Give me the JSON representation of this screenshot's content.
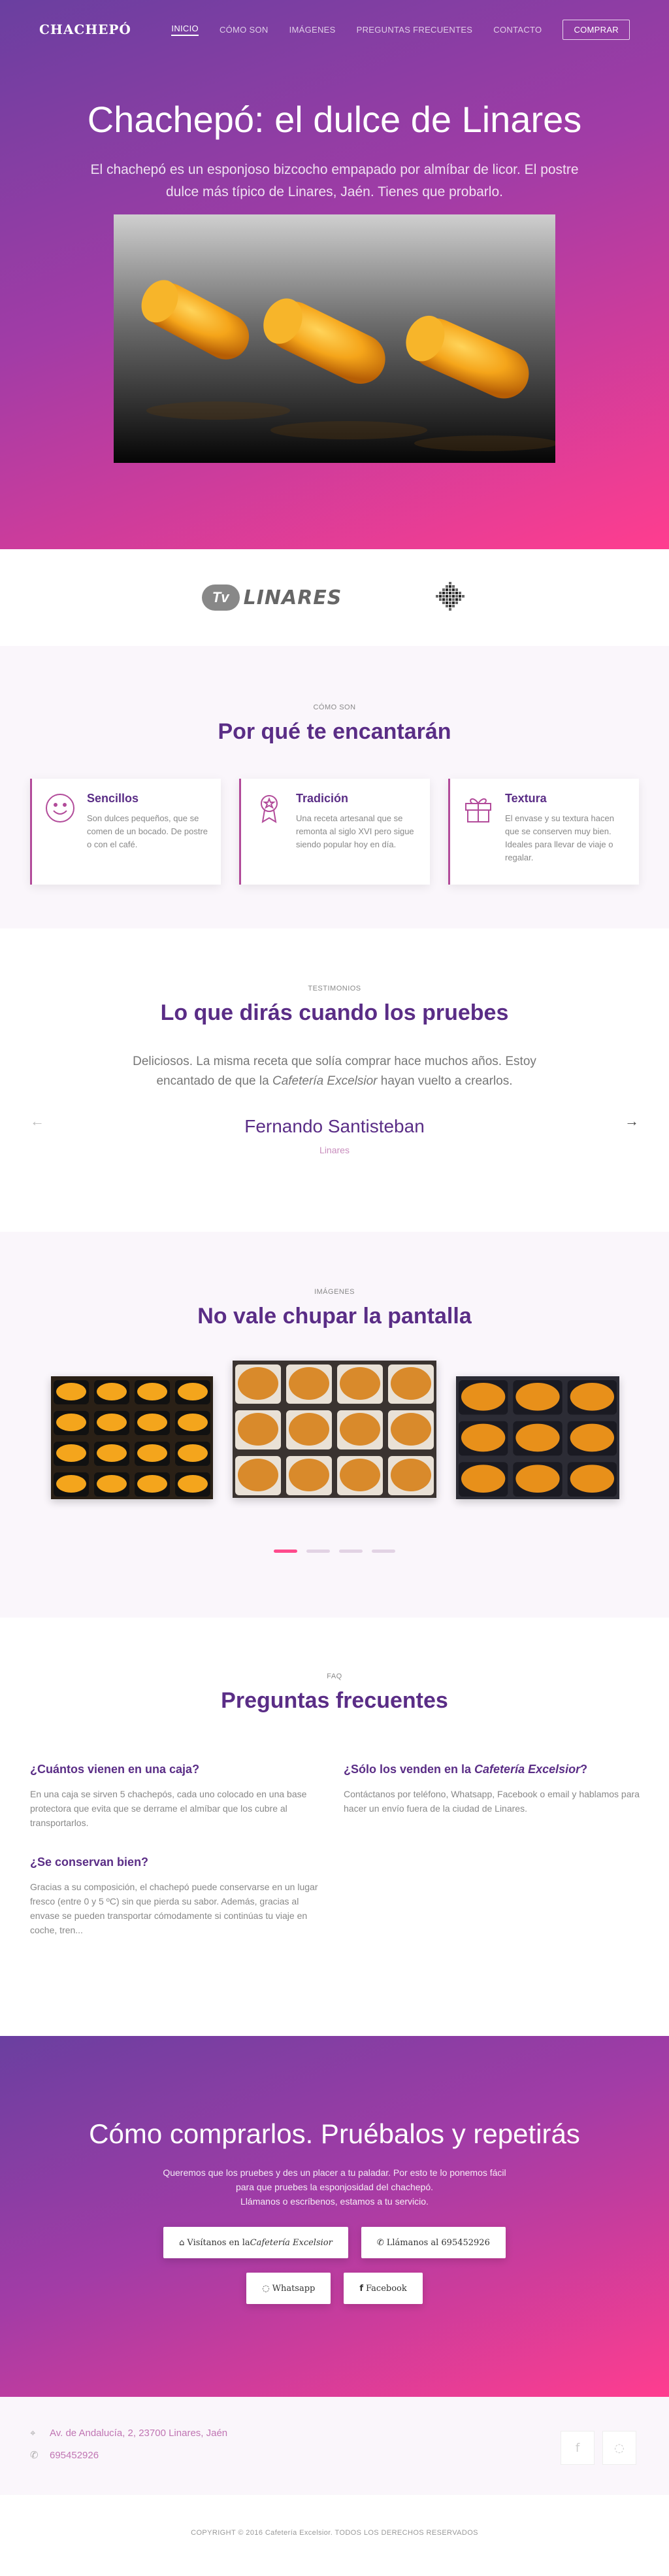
{
  "nav": {
    "brand": "CHACHEPÓ",
    "links": [
      "INICIO",
      "CÓMO SON",
      "IMÁGENES",
      "PREGUNTAS FRECUENTES",
      "CONTACTO"
    ],
    "buy": "COMPRAR"
  },
  "hero": {
    "title": "Chachepó: el dulce de Linares",
    "subtitle": "El chachepó es un esponjoso bizcocho empapado por almíbar de licor. El postre dulce más típico de Linares, Jaén. Tienes que probarlo."
  },
  "logos": {
    "tv_badge": "Tv",
    "tv_text": "LINARES"
  },
  "features": {
    "eyebrow": "CÓMO SON",
    "title": "Por qué te encantarán",
    "cards": [
      {
        "title": "Sencillos",
        "text": "Son dulces pequeños, que se comen de un bocado. De postre o con el café.",
        "icon": "smiley-icon"
      },
      {
        "title": "Tradición",
        "text": "Una receta artesanal que se remonta al siglo XVI pero sigue siendo popular hoy en día.",
        "icon": "award-ribbon-icon"
      },
      {
        "title": "Textura",
        "text": "El envase y su textura hacen que se conserven muy bien. Ideales para llevar de viaje o regalar.",
        "icon": "gift-icon"
      }
    ]
  },
  "testimonials": {
    "eyebrow": "TESTIMONIOS",
    "title": "Lo que dirás cuando los pruebes",
    "quote_start": "Deliciosos. La misma receta que solía comprar hace muchos años. Estoy encantado de que la ",
    "quote_em": "Cafetería Excelsior",
    "quote_end": " hayan vuelto a crearlos.",
    "author": "Fernando Santisteban",
    "place": "Linares",
    "prev": "←",
    "next": "→"
  },
  "gallery": {
    "eyebrow": "IMÁGENES",
    "title": "No vale chupar la pantalla",
    "active_index": 0,
    "dot_count": 4
  },
  "faq": {
    "eyebrow": "FAQ",
    "title": "Preguntas frecuentes",
    "items": [
      {
        "q": "¿Cuántos vienen en una caja?",
        "a": "En una caja se sirven 5 chachepós, cada uno colocado en una base protectora que evita que se derrame el almíbar que los cubre al transportarlos."
      },
      {
        "q_start": "¿Sólo los venden en la ",
        "q_em": "Cafetería Excelsior",
        "q_end": "?",
        "a": "Contáctanos por teléfono, Whatsapp, Facebook o email y hablamos para hacer un envío fuera de la ciudad de Linares."
      },
      {
        "q": "¿Se conservan bien?",
        "a": "Gracias a su composición, el chachepó puede conservarse en un lugar fresco (entre 0 y 5 ºC) sin que pierda su sabor. Además, gracias al envase se pueden transportar cómodamente si continúas tu viaje en coche, tren..."
      }
    ]
  },
  "buy": {
    "title": "Cómo comprarlos. Pruébalos y repetirás",
    "text_1": "Queremos que los pruebes y des un placer a tu paladar. Por esto te lo ponemos fácil para que pruebes la esponjosidad del chachepó.",
    "text_2": "Llámanos o escríbenos, estamos a tu servicio.",
    "btn_visit": "Visítanos en la ",
    "btn_visit_em": "Cafetería Excelsior",
    "btn_call": "Llámanos al 695452926",
    "btn_whatsapp": "Whatsapp",
    "btn_facebook": "Facebook"
  },
  "contact": {
    "address": "Av. de Andalucía, 2, 23700 Linares, Jaén",
    "phone": "695452926"
  },
  "footer": {
    "text": "COPYRIGHT © 2016 Cafetería Excelsior. TODOS LOS DERECHOS RESERVADOS"
  },
  "colors": {
    "accent": "#5a2d86",
    "pink": "#ff3d8f",
    "card_border": "#b24b9a"
  }
}
